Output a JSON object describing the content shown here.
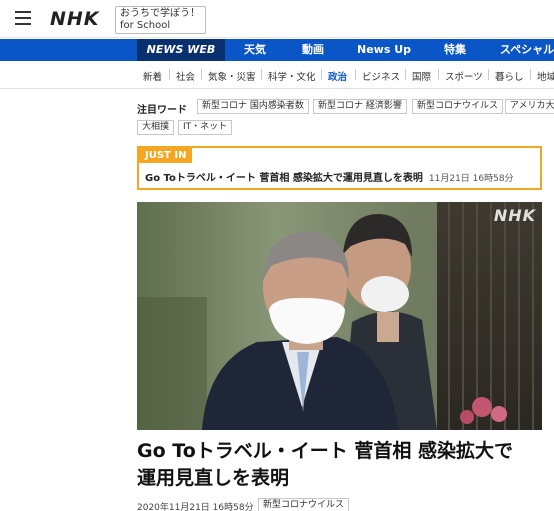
{
  "header": {
    "logo": "NHK",
    "school_line1": "おうちで学ぼう！",
    "school_line2": "for School"
  },
  "bluenav": {
    "items": [
      "NEWS WEB",
      "天気",
      "動画",
      "News Up",
      "特集",
      "スペシャル"
    ]
  },
  "subnav": {
    "items": [
      "新着",
      "社会",
      "気象・災害",
      "科学・文化",
      "政治",
      "ビジネス",
      "国際",
      "スポーツ",
      "暮らし",
      "地域"
    ],
    "current": "政治"
  },
  "keywords": {
    "title": "注目ワード",
    "tags": [
      "新型コロナ 国内感染者数",
      "新型コロナ 経済影響",
      "新型コロナウイルス",
      "アメリカ大統",
      "大相撲",
      "IT・ネット"
    ]
  },
  "justin": {
    "label": "JUST IN",
    "text": "Go Toトラベル・イート 菅首相 感染拡大で運用見直しを表明",
    "time": "11月21日 16時58分"
  },
  "photo": {
    "watermark": "NHK"
  },
  "article": {
    "headline_line1": "Go Toトラベル・イート 菅首相 感染拡大で",
    "headline_line2": "運用見直しを表明",
    "date": "2020年11月21日 16時58分",
    "tag": "新型コロナウイルス"
  }
}
